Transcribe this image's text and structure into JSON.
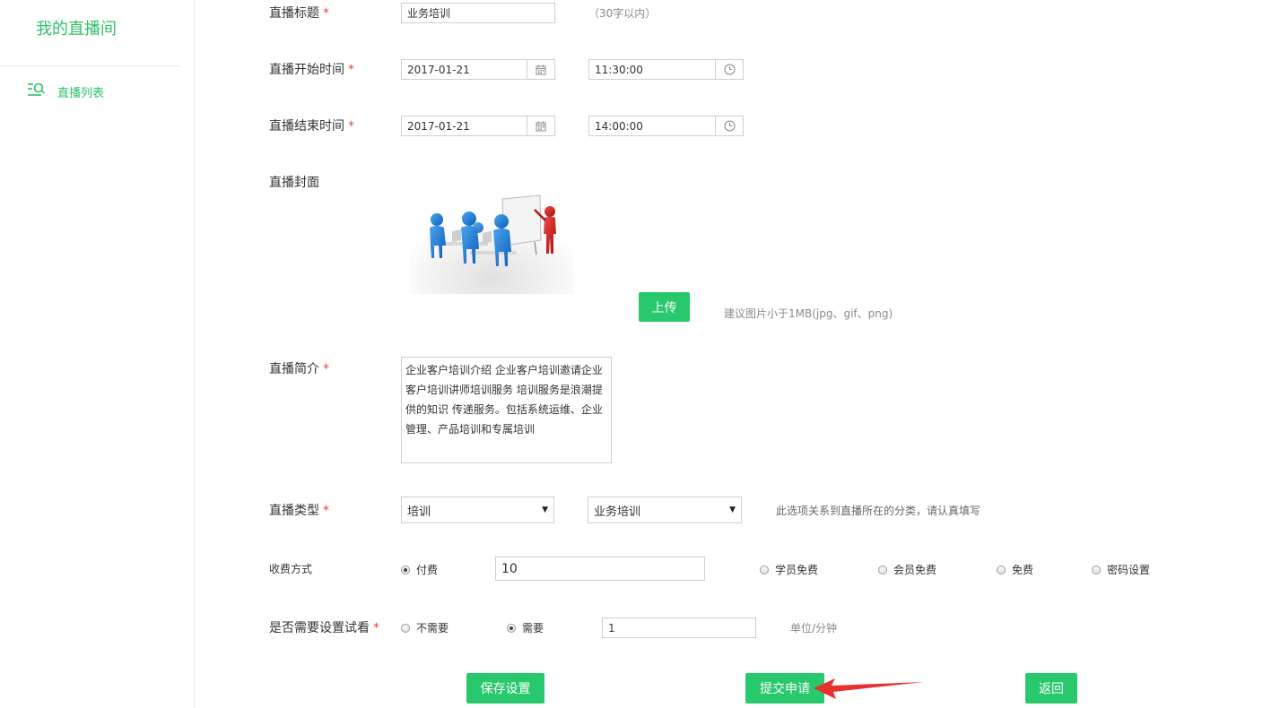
{
  "sidebar": {
    "title": "我的直播间",
    "items": [
      {
        "label": "直播列表",
        "icon": "list-search-icon"
      }
    ]
  },
  "form": {
    "title": {
      "label": "直播标题",
      "value": "业务培训",
      "hint": "（30字以内）"
    },
    "start": {
      "label": "直播开始时间",
      "date": "2017-01-21",
      "time": "11:30:00"
    },
    "end": {
      "label": "直播结束时间",
      "date": "2017-01-21",
      "time": "14:00:00"
    },
    "cover": {
      "label": "直播封面",
      "upload_label": "上传",
      "hint": "建议图片小于1MB(jpg、gif、png)"
    },
    "intro": {
      "label": "直播简介",
      "value": "企业客户培训介绍 企业客户培训邀请企业客户培训讲师培训服务 培训服务是浪潮提供的知识 传递服务。包括系统运维、企业管理、产品培训和专属培训"
    },
    "type": {
      "label": "直播类型",
      "primary": "培训",
      "secondary": "业务培训",
      "hint": "此选项关系到直播所在的分类，请认真填写"
    },
    "fee": {
      "label": "收费方式",
      "options": [
        "付费",
        "学员免费",
        "会员免费",
        "免费",
        "密码设置"
      ],
      "selected": "付费",
      "amount": "10"
    },
    "trial": {
      "label": "是否需要设置试看",
      "options": [
        "不需要",
        "需要"
      ],
      "selected": "需要",
      "minutes": "1",
      "unit": "单位/分钟"
    }
  },
  "actions": {
    "save": "保存设置",
    "submit": "提交申请",
    "back": "返回"
  },
  "colors": {
    "accent": "#28c96c",
    "required": "#e64545",
    "arrow": "#e83030"
  }
}
